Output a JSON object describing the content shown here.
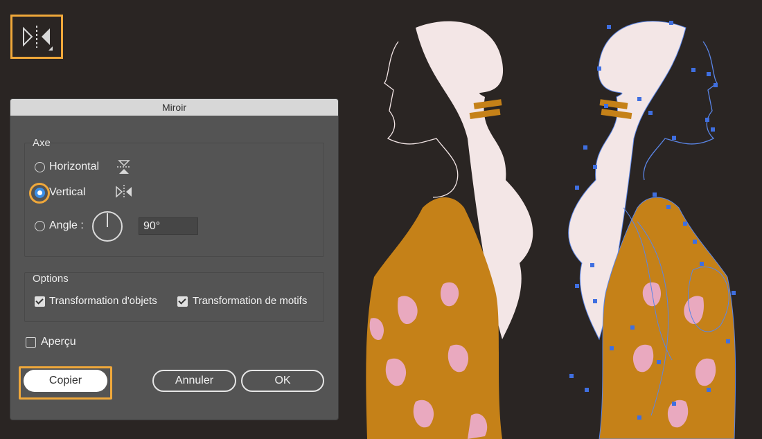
{
  "colors": {
    "accent": "#3a8ee6",
    "highlight": "#f0a83a",
    "canvas": "#2a2523"
  },
  "toolbar": {
    "tool_icon": "reflect-tool-icon"
  },
  "dialog": {
    "title": "Miroir",
    "axis": {
      "legend": "Axe",
      "horizontal_label": "Horizontal",
      "vertical_label": "Vertical",
      "angle_label": "Angle :",
      "angle_value": "90°",
      "selected": "vertical"
    },
    "options": {
      "legend": "Options",
      "transform_objects_label": "Transformation d'objets",
      "transform_patterns_label": "Transformation de motifs",
      "transform_objects_checked": true,
      "transform_patterns_checked": true
    },
    "preview": {
      "label": "Aperçu",
      "checked": false
    },
    "buttons": {
      "copy": "Copier",
      "cancel": "Annuler",
      "ok": "OK"
    }
  }
}
